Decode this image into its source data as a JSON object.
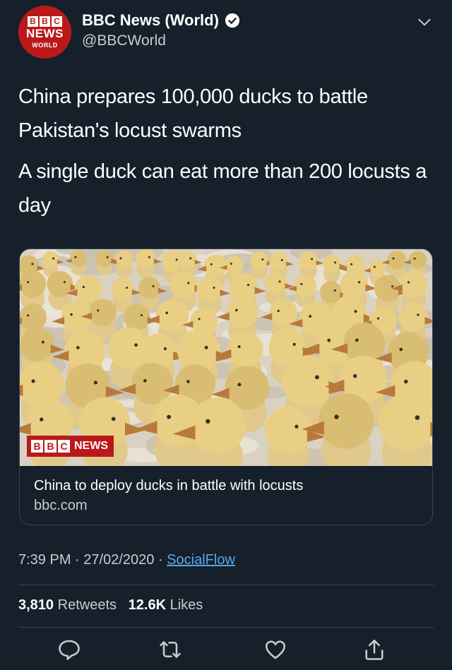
{
  "account": {
    "display_name": "BBC News (World)",
    "handle": "@BBCWorld",
    "avatar": {
      "blocks": [
        "B",
        "B",
        "C"
      ],
      "news": "NEWS",
      "sub": "WORLD"
    },
    "verified": true
  },
  "tweet": {
    "paragraphs": [
      "China prepares 100,000 ducks to battle Pakistan's locust swarms",
      "A single duck can eat more than 200 locusts a day"
    ]
  },
  "card": {
    "watermark_blocks": [
      "B",
      "B",
      "C"
    ],
    "watermark_text": "NEWS",
    "title": "China to deploy ducks in battle with locusts",
    "domain": "bbc.com"
  },
  "meta": {
    "time": "7:39 PM",
    "date": "27/02/2020",
    "separator": "·",
    "source": "SocialFlow"
  },
  "stats": {
    "retweets_count": "3,810",
    "retweets_label": "Retweets",
    "likes_count": "12.6K",
    "likes_label": "Likes"
  },
  "actions": [
    "reply-icon",
    "retweet-icon",
    "like-icon",
    "share-icon"
  ],
  "colors": {
    "background": "#15202b",
    "border": "#38444d",
    "secondary_text": "#c8ccd0",
    "link": "#5aa7e4",
    "bbc_red": "#bb1919"
  }
}
